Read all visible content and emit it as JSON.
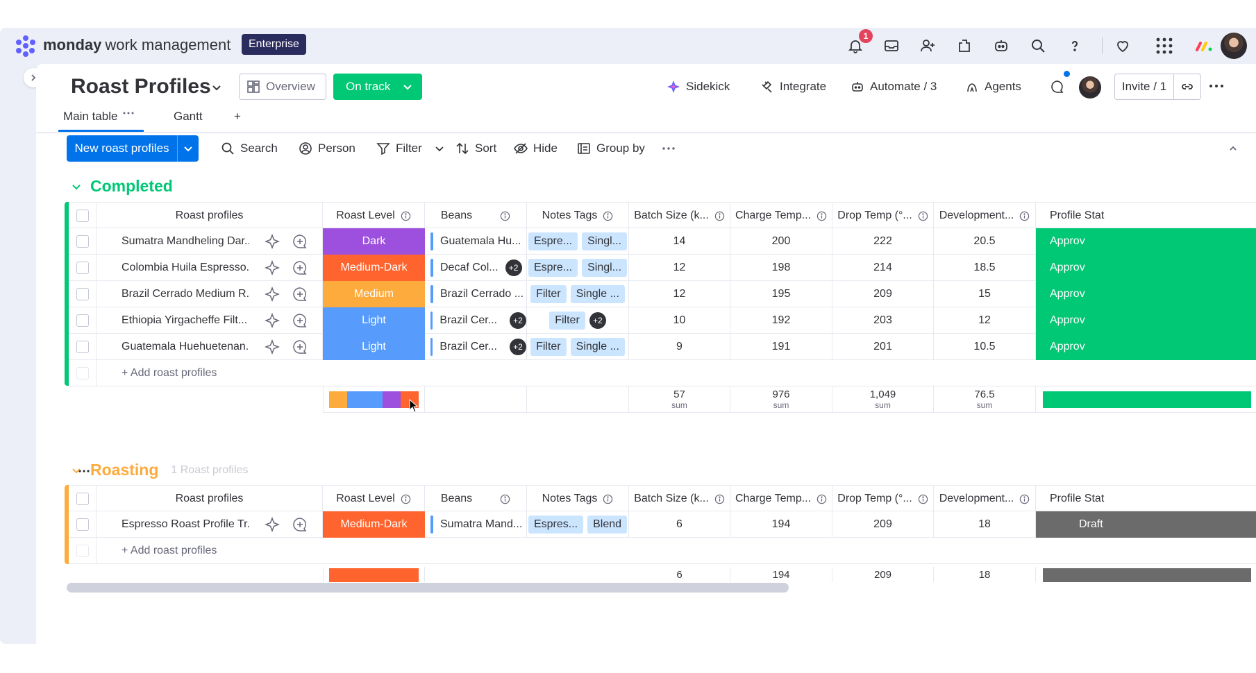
{
  "app": {
    "brand_bold": "monday",
    "brand_rest": "work management",
    "plan_badge": "Enterprise",
    "notification_count": "1"
  },
  "board": {
    "title": "Roast Profiles",
    "overview_label": "Overview",
    "status_label": "On track",
    "actions": {
      "sidekick": "Sidekick",
      "integrate": "Integrate",
      "automate": "Automate / 3",
      "agents": "Agents",
      "invite": "Invite / 1"
    },
    "tabs": [
      {
        "label": "Main table"
      },
      {
        "label": "Gantt"
      }
    ],
    "add_tab": "+"
  },
  "toolbar": {
    "new_item": "New roast profiles",
    "search": "Search",
    "person": "Person",
    "filter": "Filter",
    "sort": "Sort",
    "hide": "Hide",
    "group_by": "Group by"
  },
  "columns": {
    "name": "Roast profiles",
    "roast_level": "Roast Level",
    "beans": "Beans",
    "notes_tags": "Notes Tags",
    "batch_size": "Batch Size (k...",
    "charge_temp": "Charge Temp...",
    "drop_temp": "Drop Temp (°...",
    "development": "Development...",
    "profile_status": "Profile Stat"
  },
  "colors": {
    "completed": "#00c875",
    "roasting": "#fdab3d",
    "dark": "#9d50dd",
    "medium_dark": "#ff642e",
    "medium": "#fdab3d",
    "light": "#579bfc",
    "approved": "#00c875",
    "draft": "#6b6b6b",
    "primary": "#0073ea"
  },
  "groups": [
    {
      "title": "Completed",
      "subtitle": "",
      "add_label": "+ Add roast profiles",
      "rows": [
        {
          "name": "Sumatra Mandheling Dar...",
          "roast": "Dark",
          "roast_color": "#9d50dd",
          "beans": "Guatemala Hu...",
          "beans_extra": "",
          "tags": [
            "Espre...",
            "Singl..."
          ],
          "tags_extra": "",
          "batch": "14",
          "charge": "200",
          "drop": "222",
          "dev": "20.5",
          "status": "Approv",
          "status_color": "#00c875"
        },
        {
          "name": "Colombia Huila Espresso...",
          "roast": "Medium-Dark",
          "roast_color": "#ff642e",
          "beans": "Decaf Col...",
          "beans_extra": "+2",
          "tags": [
            "Espre...",
            "Singl..."
          ],
          "tags_extra": "",
          "batch": "12",
          "charge": "198",
          "drop": "214",
          "dev": "18.5",
          "status": "Approv",
          "status_color": "#00c875"
        },
        {
          "name": "Brazil Cerrado Medium R...",
          "roast": "Medium",
          "roast_color": "#fdab3d",
          "beans": "Brazil Cerrado ...",
          "beans_extra": "",
          "tags": [
            "Filter",
            "Single ..."
          ],
          "tags_extra": "",
          "batch": "12",
          "charge": "195",
          "drop": "209",
          "dev": "15",
          "status": "Approv",
          "status_color": "#00c875"
        },
        {
          "name": "Ethiopia Yirgacheffe Filt...",
          "roast": "Light",
          "roast_color": "#579bfc",
          "beans": "Brazil Cer...",
          "beans_extra": "+2",
          "tags": [
            "Filter"
          ],
          "tags_extra": "+2",
          "batch": "10",
          "charge": "192",
          "drop": "203",
          "dev": "12",
          "status": "Approv",
          "status_color": "#00c875"
        },
        {
          "name": "Guatemala Huehuetenan...",
          "roast": "Light",
          "roast_color": "#579bfc",
          "beans": "Brazil Cer...",
          "beans_extra": "+2",
          "tags": [
            "Filter",
            "Single ..."
          ],
          "tags_extra": "",
          "batch": "9",
          "charge": "191",
          "drop": "201",
          "dev": "10.5",
          "status": "Approv",
          "status_color": "#00c875"
        }
      ],
      "summary": {
        "roast_distribution": [
          {
            "color": "#fdab3d",
            "fraction": 0.2
          },
          {
            "color": "#579bfc",
            "fraction": 0.4
          },
          {
            "color": "#9d50dd",
            "fraction": 0.2
          },
          {
            "color": "#ff642e",
            "fraction": 0.2
          }
        ],
        "batch": "57",
        "charge": "976",
        "drop": "1,049",
        "dev": "76.5",
        "sum_label": "sum"
      }
    },
    {
      "title": "Roasting",
      "subtitle": "1 Roast profiles",
      "add_label": "+ Add roast profiles",
      "rows": [
        {
          "name": "Espresso Roast Profile Tr...",
          "roast": "Medium-Dark",
          "roast_color": "#ff642e",
          "beans": "Sumatra Mand...",
          "beans_extra": "",
          "tags": [
            "Espres...",
            "Blend"
          ],
          "tags_extra": "",
          "batch": "6",
          "charge": "194",
          "drop": "209",
          "dev": "18",
          "status": "Draft",
          "status_color": "#6b6b6b"
        }
      ],
      "summary": {
        "batch": "6",
        "charge": "194",
        "drop": "209",
        "dev": "18"
      }
    }
  ]
}
